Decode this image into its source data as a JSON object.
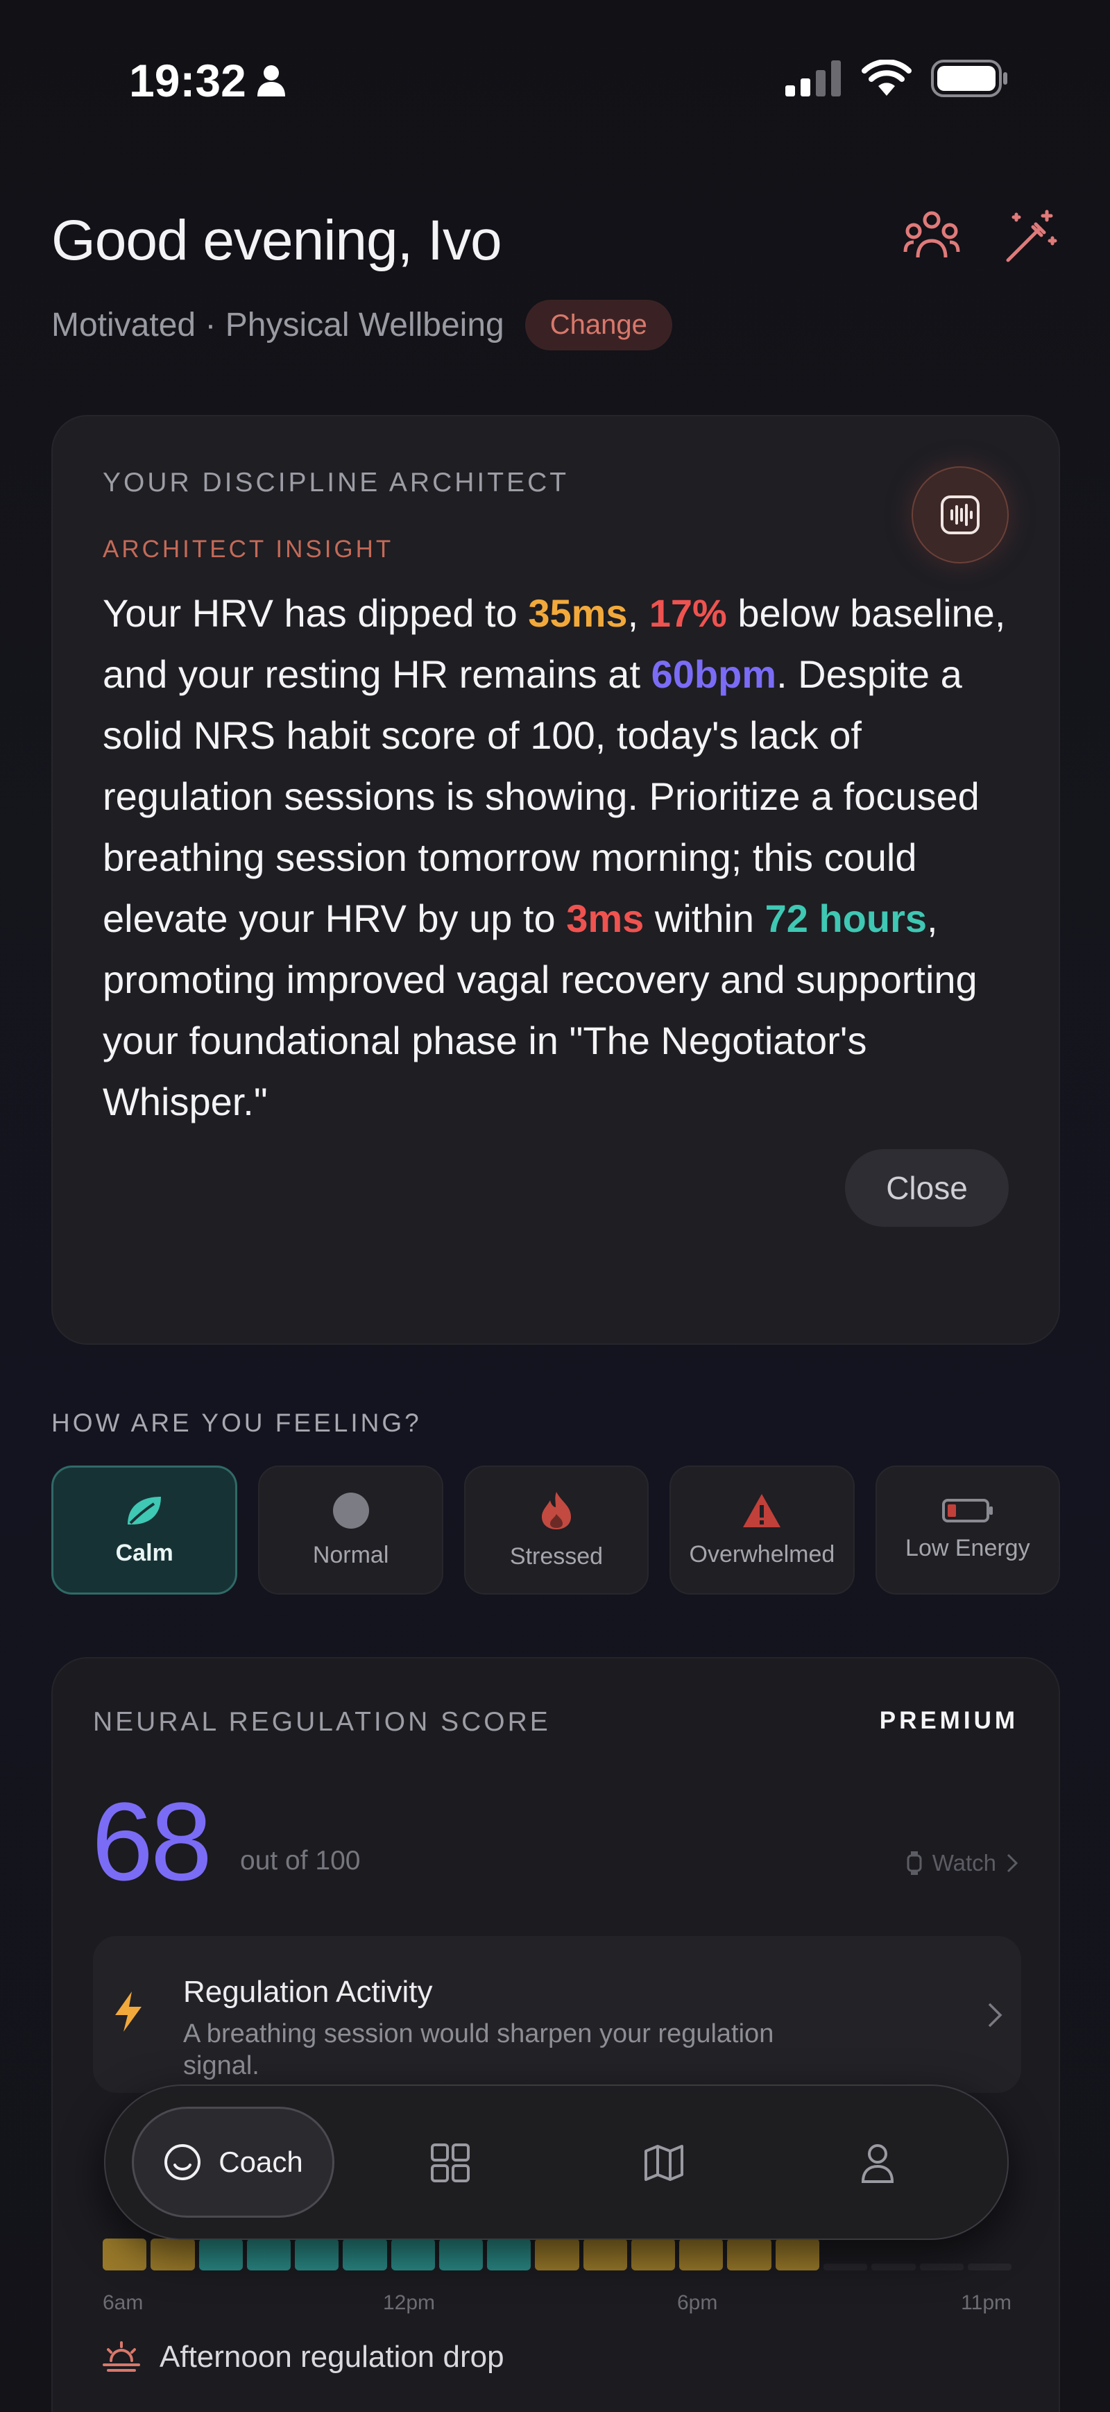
{
  "status_bar": {
    "time": "19:32"
  },
  "header": {
    "greeting": "Good evening, Ivo",
    "subtitle": "Motivated · Physical Wellbeing",
    "change_label": "Change"
  },
  "insight_card": {
    "label": "YOUR DISCIPLINE ARCHITECT",
    "sub_label": "ARCHITECT INSIGHT",
    "text_parts": [
      "Your HRV has dipped to ",
      "35ms",
      ", ",
      "17%",
      " below baseline, and your resting HR remains at ",
      "60bpm",
      ". Despite a solid NRS habit score of 100, today's lack of regulation sessions is showing. Prioritize a focused breathing session tomorrow morning; this could elevate your HRV by up to ",
      "3ms",
      " within ",
      "72 hours",
      ", promoting improved vagal recovery and supporting your foundational phase in \"The Negotiator's Whisper.\""
    ],
    "close_label": "Close",
    "colors": {
      "orange": "#f2a93b",
      "red": "#ef5350",
      "purple": "#7b6cf6",
      "teal": "#3fc8b4"
    }
  },
  "feeling": {
    "title": "HOW ARE YOU FEELING?",
    "options": [
      {
        "label": "Calm",
        "icon": "leaf-icon",
        "active": true
      },
      {
        "label": "Normal",
        "icon": "circle-icon",
        "active": false
      },
      {
        "label": "Stressed",
        "icon": "flame-icon",
        "active": false
      },
      {
        "label": "Overwhelmed",
        "icon": "warning-icon",
        "active": false
      },
      {
        "label": "Low Energy",
        "icon": "battery-low-icon",
        "active": false
      }
    ]
  },
  "nrs": {
    "label": "NEURAL REGULATION SCORE",
    "premium": "PREMIUM",
    "score": "68",
    "score_of": "out of 100",
    "watch_label": "Watch",
    "activity_title": "Regulation Activity",
    "activity_desc": "A breathing session would sharpen your regulation signal.",
    "timeline_labels": [
      "6am",
      "12pm",
      "6pm",
      "11pm"
    ],
    "timeline_segments": [
      "y",
      "y",
      "t",
      "t",
      "t",
      "t",
      "t",
      "t",
      "t",
      "y",
      "y",
      "y",
      "y",
      "y",
      "y",
      "e",
      "e",
      "e",
      "e"
    ],
    "drop_label": "Afternoon regulation drop"
  },
  "nav": {
    "coach_label": "Coach",
    "items": [
      "dashboard-icon",
      "map-icon",
      "profile-icon"
    ]
  }
}
